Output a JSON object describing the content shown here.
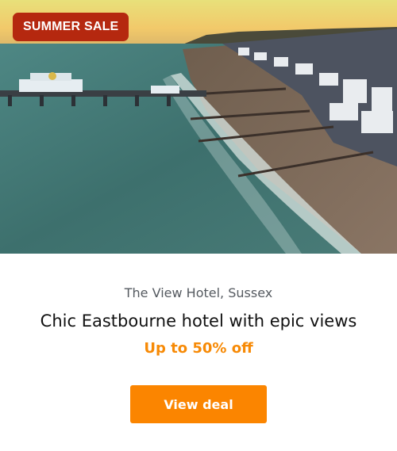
{
  "hero": {
    "badge_label": "SUMMER SALE",
    "badge_color": "#b5280f"
  },
  "card": {
    "location": "The View Hotel, Sussex",
    "title": "Chic Eastbourne hotel with epic views",
    "offer": "Up to 50% off",
    "cta_label": "View deal"
  },
  "colors": {
    "accent": "#fb8500",
    "offer_text": "#f78a06"
  }
}
